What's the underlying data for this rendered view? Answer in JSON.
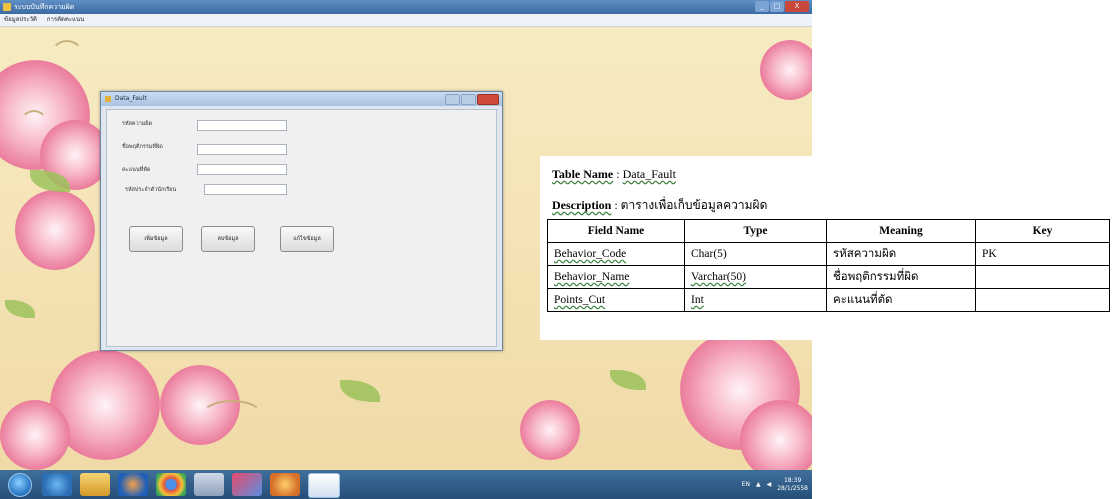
{
  "desktop": {
    "outer_window": {
      "title": "ระบบบันทึกความผิด",
      "menu": [
        "ข้อมูลประวัติ",
        "การตัดคะแนน"
      ],
      "controls": [
        "_",
        "□",
        "X"
      ]
    },
    "data_fault_window": {
      "title": "Data_Fault",
      "fields": [
        {
          "label": "รหัสความผิด",
          "value": ""
        },
        {
          "label": "ชื่อพฤติกรรมที่ผิด",
          "value": ""
        },
        {
          "label": "คะแนนที่ตัด",
          "value": ""
        },
        {
          "label": "รหัสประจำตัวนักเรียน",
          "value": ""
        }
      ],
      "buttons": [
        "เพิ่มข้อมูล",
        "ลบข้อมูล",
        "แก้ไขข้อมูล"
      ]
    },
    "taskbar": {
      "tray": {
        "language": "EN",
        "time": "18:39",
        "date": "28/1/2558"
      }
    }
  },
  "document": {
    "table_name_label": "Table Name",
    "table_name_value": "Data_Fault",
    "description_label": "Description",
    "description_value": "ตารางเพื่อเก็บข้อมูลความผิด",
    "columns": [
      "Field Name",
      "Type",
      "Meaning",
      "Key"
    ],
    "rows": [
      [
        "Behavior_Code",
        "Char(5)",
        "รหัสความผิด",
        "PK"
      ],
      [
        "Behavior_Name",
        "Varchar(50)",
        "ชื่อพฤติกรรมที่ผิด",
        ""
      ],
      [
        "Points_Cut",
        "Int",
        "คะแนนที่ตัด",
        ""
      ]
    ]
  }
}
